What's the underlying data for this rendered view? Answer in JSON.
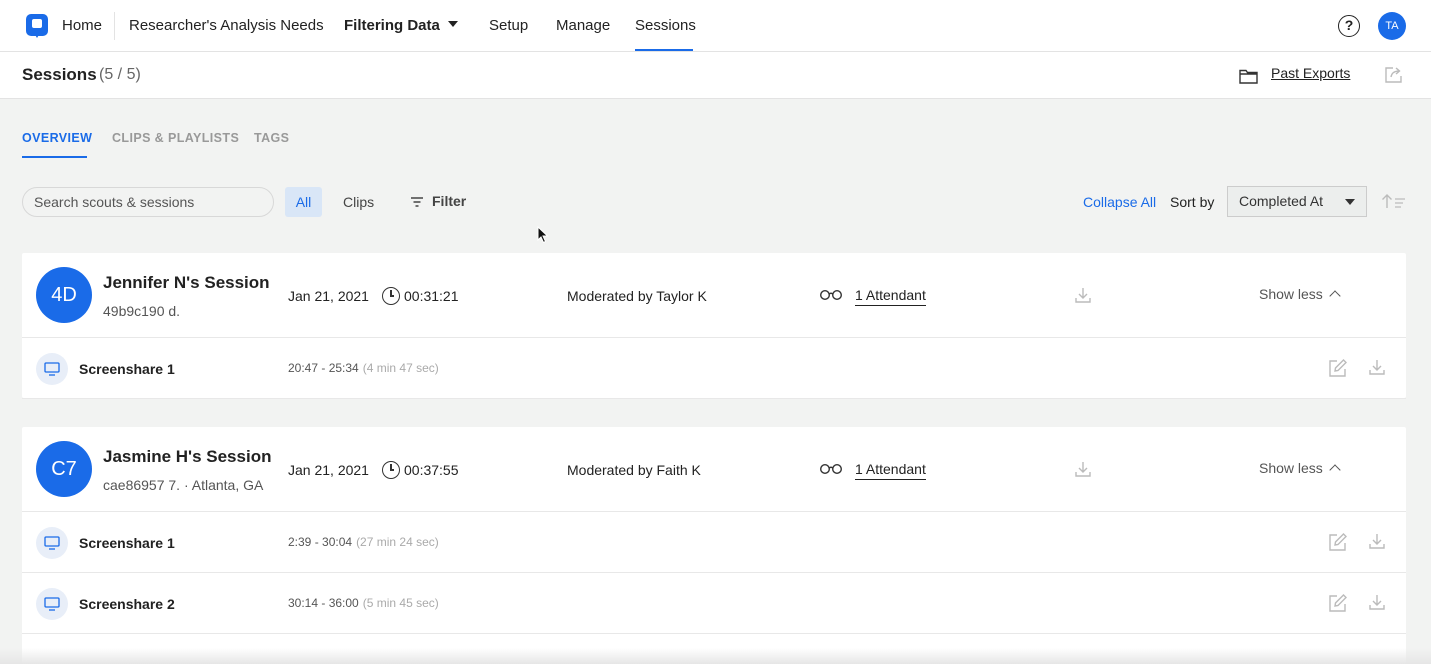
{
  "nav": {
    "home": "Home",
    "project": "Researcher's Analysis Needs",
    "study": "Filtering Data",
    "setup": "Setup",
    "manage": "Manage",
    "sessions": "Sessions",
    "help": "?",
    "user_initials": "TA"
  },
  "header": {
    "title": "Sessions",
    "count": "(5 / 5)",
    "past_exports": "Past Exports"
  },
  "tabs": [
    {
      "label": "OVERVIEW",
      "active": true
    },
    {
      "label": "CLIPS & PLAYLISTS",
      "active": false
    },
    {
      "label": "TAGS",
      "active": false
    }
  ],
  "toolbar": {
    "search_placeholder": "Search scouts & sessions",
    "seg_all": "All",
    "seg_clips": "Clips",
    "filter": "Filter",
    "collapse_all": "Collapse All",
    "sort_by": "Sort by",
    "sort_value": "Completed At"
  },
  "sessions": [
    {
      "initials": "4D",
      "name": "Jennifer N's Session",
      "sub": "49b9c190 d.",
      "date": "Jan 21, 2021",
      "duration": "00:31:21",
      "moderator": "Moderated by Taylor K",
      "attendants": "1 Attendant",
      "toggle": "Show less",
      "clips": [
        {
          "name": "Screenshare 1",
          "range": "20:47 - 25:34",
          "length": "(4 min 47 sec)"
        }
      ]
    },
    {
      "initials": "C7",
      "name": "Jasmine H's Session",
      "sub": "cae86957 7. · Atlanta, GA",
      "date": "Jan 21, 2021",
      "duration": "00:37:55",
      "moderator": "Moderated by Faith K",
      "attendants": "1 Attendant",
      "toggle": "Show less",
      "clips": [
        {
          "name": "Screenshare 1",
          "range": "2:39 - 30:04",
          "length": "(27 min 24 sec)"
        },
        {
          "name": "Screenshare 2",
          "range": "30:14 - 36:00",
          "length": "(5 min 45 sec)"
        }
      ]
    }
  ],
  "colors": {
    "accent": "#1a6be8",
    "background": "#f2f3f2"
  }
}
